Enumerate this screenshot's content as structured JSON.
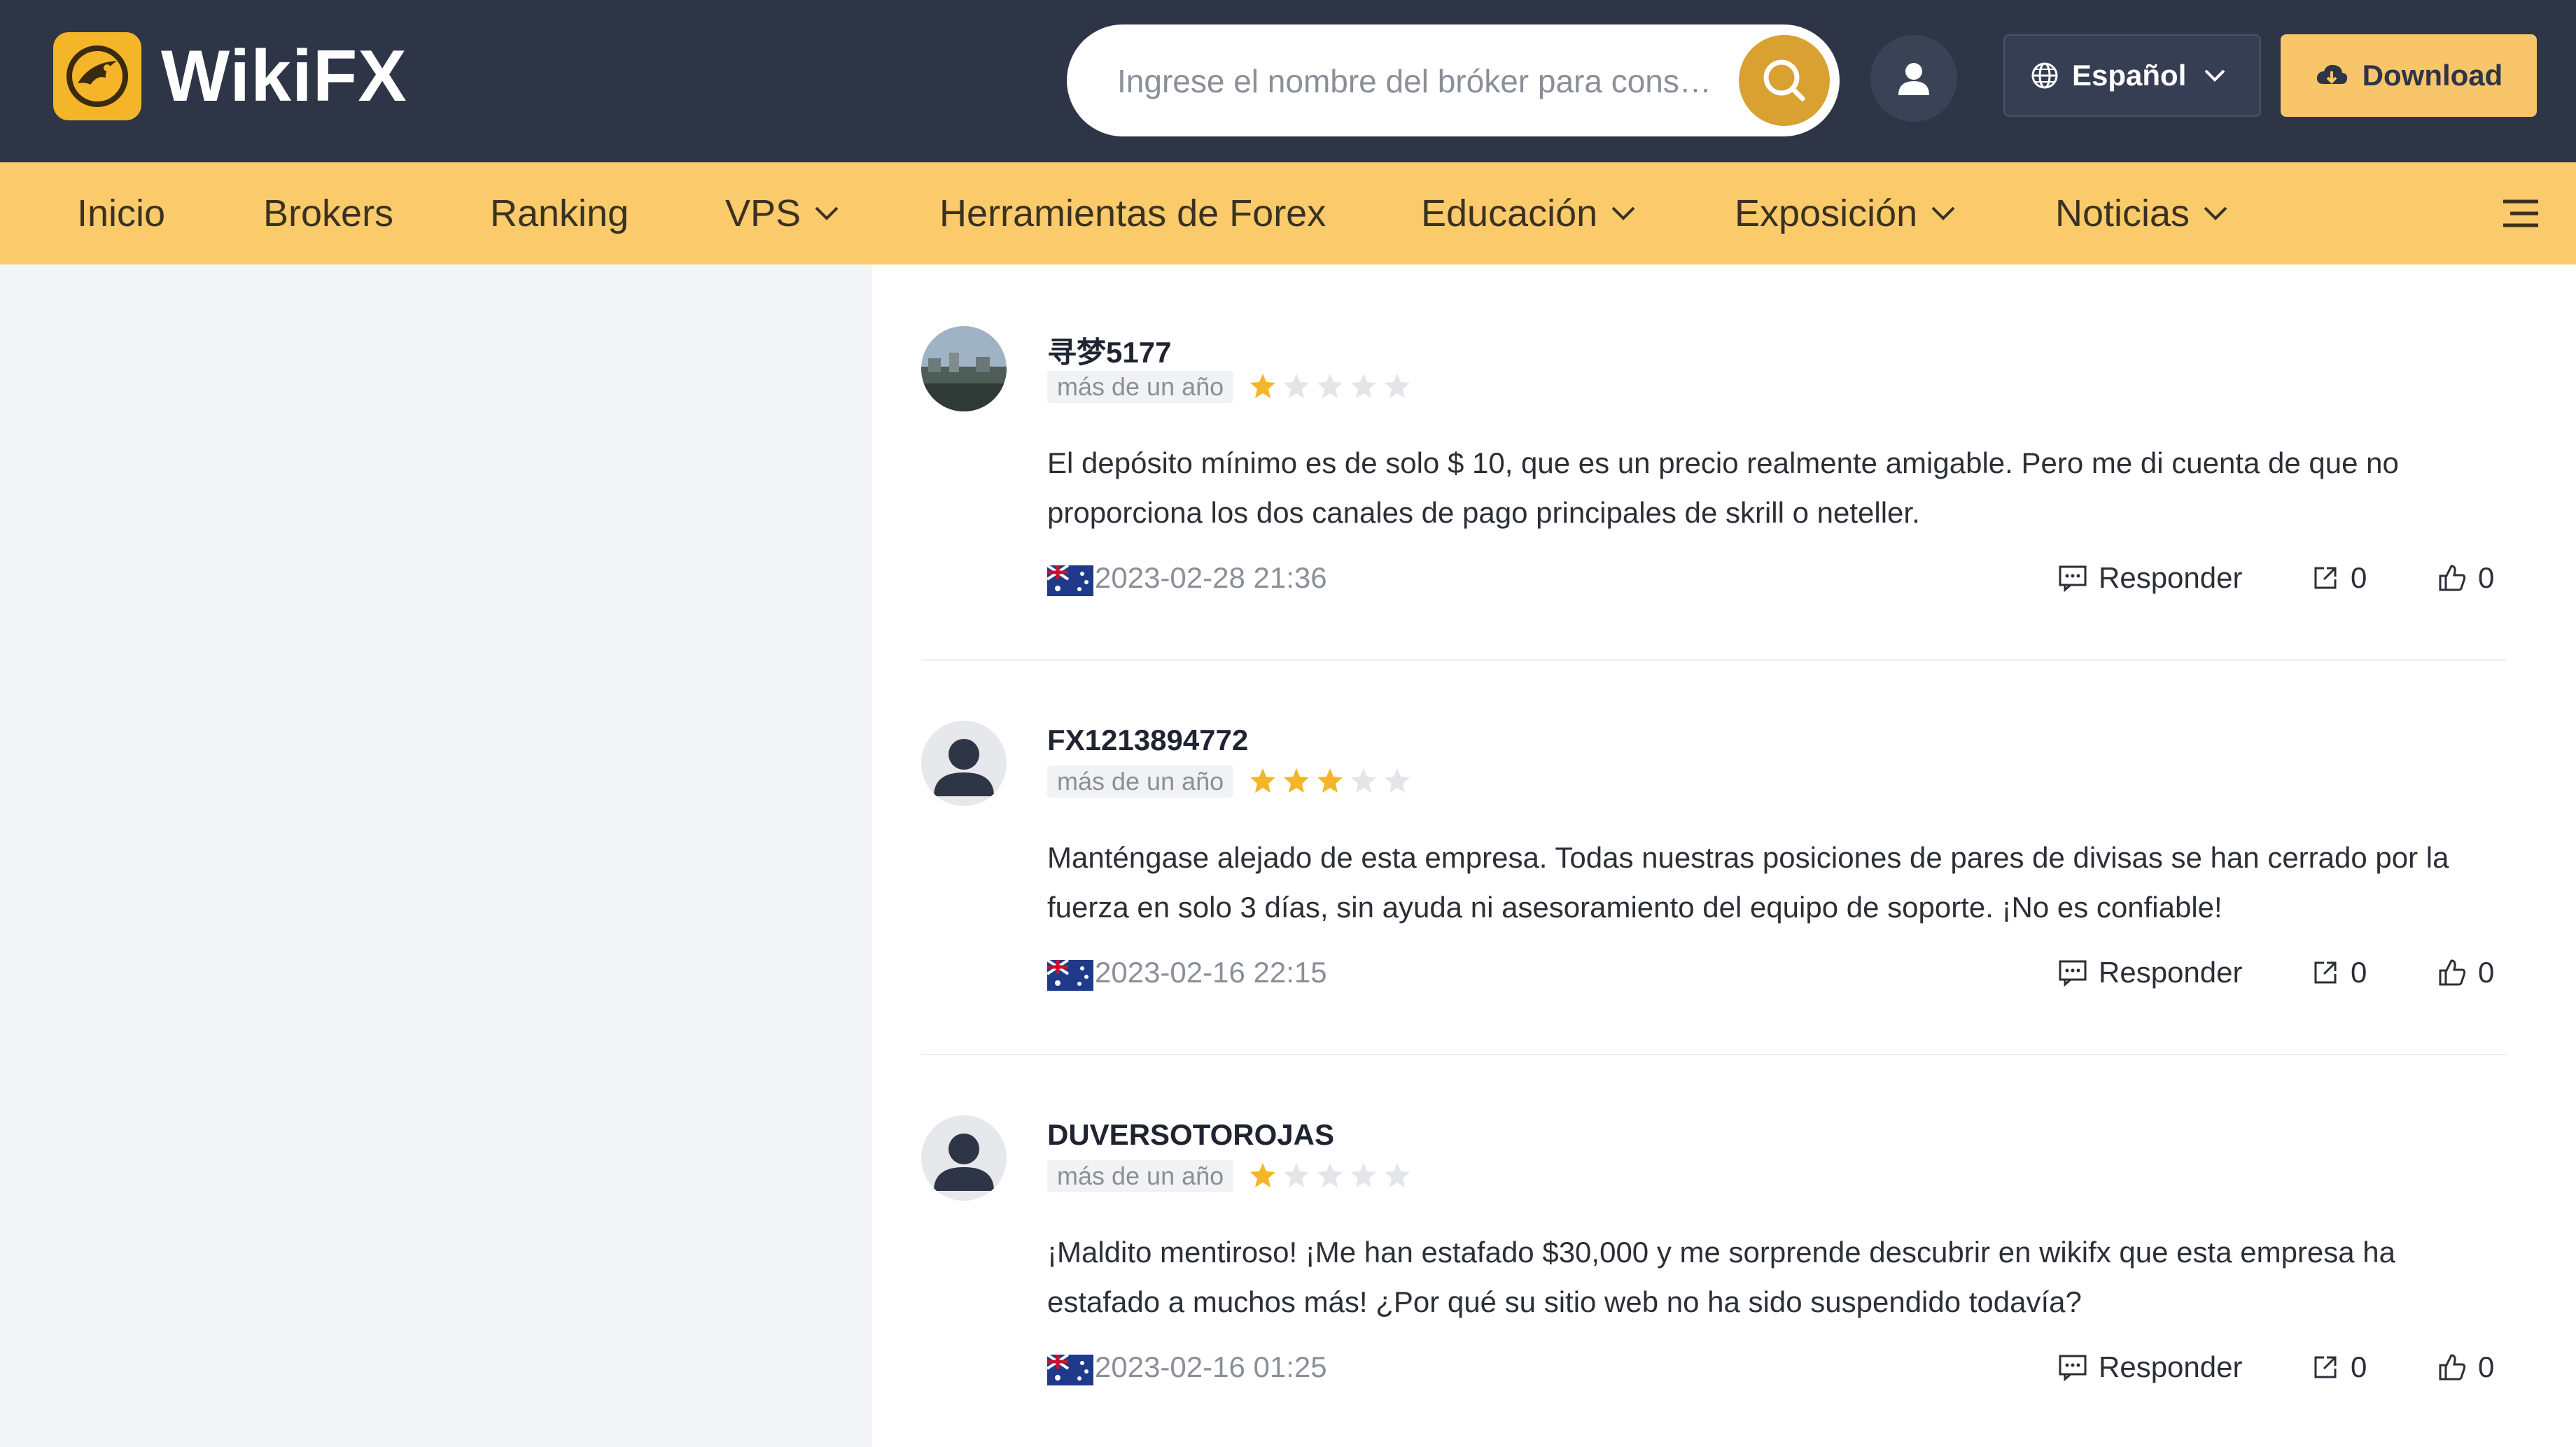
{
  "header": {
    "logo_text": "WikiFX",
    "search_placeholder": "Ingrese el nombre del bróker para cons…",
    "language": "Español",
    "download_label": "Download"
  },
  "nav": {
    "items": [
      {
        "label": "Inicio"
      },
      {
        "label": "Brokers"
      },
      {
        "label": "Ranking"
      },
      {
        "label": "VPS"
      },
      {
        "label": "Herramientas de Forex"
      },
      {
        "label": "Educación"
      },
      {
        "label": "Exposición"
      },
      {
        "label": "Noticias"
      }
    ]
  },
  "reviews": [
    {
      "username": "寻梦5177",
      "time": "más de un año",
      "rating": 1,
      "text": "El depósito mínimo es de solo $ 10, que es un precio realmente amigable. Pero me di cuenta de que no proporciona los dos canales de pago principales de skrill o neteller.",
      "date": "2023-02-28 21:36",
      "reply_label": "Responder",
      "share_count": "0",
      "like_count": "0"
    },
    {
      "username": "FX1213894772",
      "time": "más de un año",
      "rating": 3,
      "text": "Manténgase alejado de esta empresa. Todas nuestras posiciones de pares de divisas se han cerrado por la fuerza en solo 3 días, sin ayuda ni asesoramiento del equipo de soporte. ¡No es confiable!",
      "date": "2023-02-16 22:15",
      "reply_label": "Responder",
      "share_count": "0",
      "like_count": "0"
    },
    {
      "username": "DUVERSOTOROJAS",
      "time": "más de un año",
      "rating": 1,
      "text": "¡Maldito mentiroso! ¡Me han estafado $30,000 y me sorprende descubrir en wikifx que esta empresa ha estafado a muchos más! ¿Por qué su sitio web no ha sido suspendido todavía?",
      "date": "2023-02-16 01:25",
      "reply_label": "Responder",
      "share_count": "0",
      "like_count": "0"
    }
  ],
  "colors": {
    "header_bg": "#2d3546",
    "nav_bg": "#fbca6b",
    "accent": "#f4b628",
    "star_active": "#f4b628",
    "star_inactive": "#e3e5e8"
  }
}
